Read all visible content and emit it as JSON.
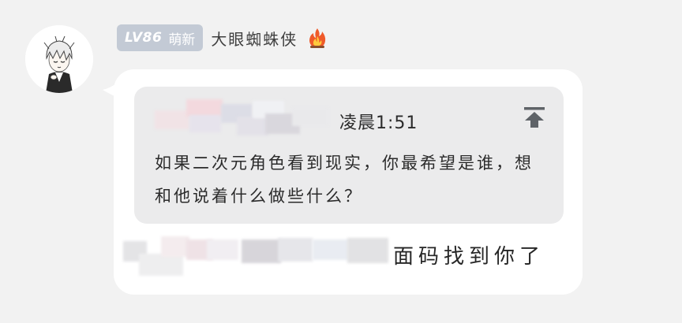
{
  "user": {
    "level": "LV86",
    "level_title": "萌新",
    "username": "大眼蜘蛛侠",
    "avatar_icon": "anime-boy-avatar-icon",
    "badge_icon": "fire-icon"
  },
  "message": {
    "quote": {
      "time": "凌晨1:51",
      "text": "如果二次元角色看到现实，你最希望是谁，想和他说着什么做些什么？",
      "jump_icon": "scroll-to-top-icon"
    },
    "reply_text": "面码找到你了"
  },
  "colors": {
    "background": "#f2f2f2",
    "bubble": "#ffffff",
    "quote_card": "#ebebec",
    "level_badge": "#c3cad5"
  }
}
